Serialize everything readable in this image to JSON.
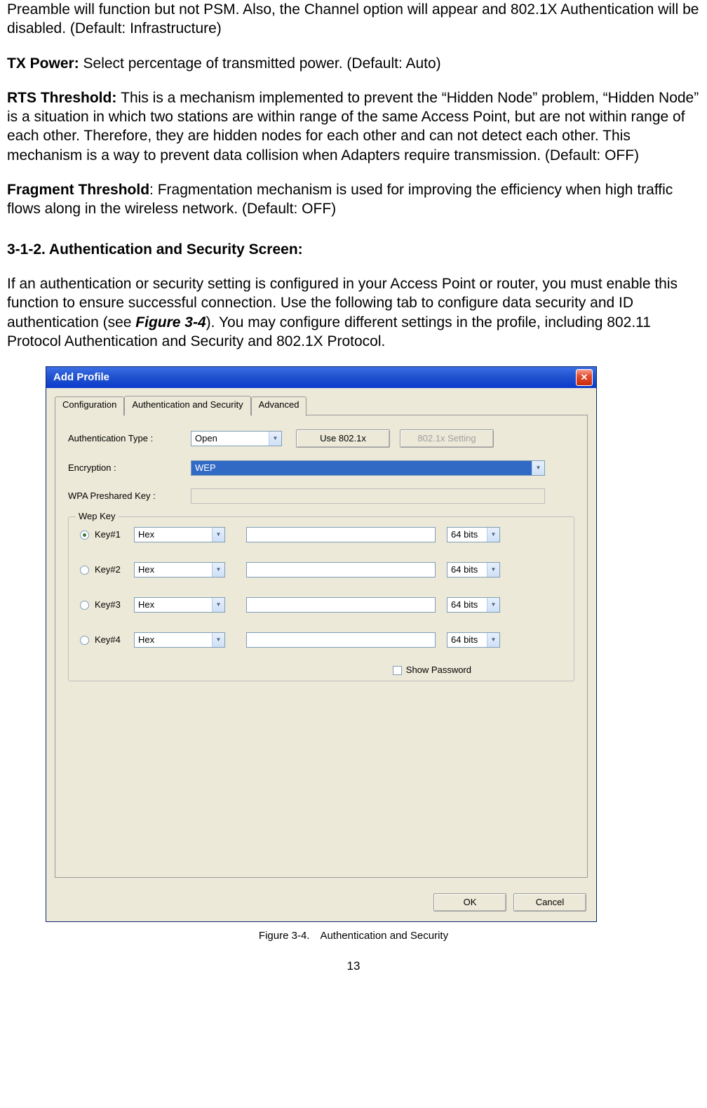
{
  "doc": {
    "para1": "Preamble will function but not PSM. Also, the Channel option will appear and 802.1X Authentication will be disabled. (Default: Infrastructure)",
    "tx_label": "TX Power: ",
    "tx_text": "Select percentage of transmitted power. (Default: Auto)",
    "rts_label": "RTS Threshold: ",
    "rts_text": "This is a mechanism implemented to prevent the “Hidden Node” problem, “Hidden Node” is a situation in which two stations are within range of the same Access Point, but are not within range of each other. Therefore, they are hidden nodes for each other and can not detect each other. This mechanism is a way to prevent data collision when Adapters require transmission. (Default: OFF)",
    "frag_label": "Fragment Threshold",
    "frag_text": ": Fragmentation mechanism is used for improving the efficiency when high traffic flows along in the wireless network. (Default: OFF)",
    "section_heading": "3-1-2. Authentication and Security Screen:",
    "para_intro_a": "If an authentication or security setting is configured in your Access Point or router, you must enable this function to ensure successful connection. Use the following tab to configure data security and ID authentication (see ",
    "para_intro_figref": "Figure 3-4",
    "para_intro_b": "). You may configure different settings in the profile, including 802.11 Protocol Authentication and Security and 802.1X Protocol.",
    "figure_caption": "Figure 3-4. Authentication and Security",
    "page_number": "13"
  },
  "dialog": {
    "title": "Add Profile",
    "tabs": [
      "Configuration",
      "Authentication and Security",
      "Advanced"
    ],
    "auth_type_label": "Authentication Type :",
    "auth_type_value": "Open",
    "use8021x_label": "Use 802.1x",
    "setting8021x_label": "802.1x Setting",
    "encryption_label": "Encryption :",
    "encryption_value": "WEP",
    "wpa_label": "WPA Preshared Key :",
    "wepkey_legend": "Wep Key",
    "keys": [
      {
        "label": "Key#1",
        "format": "Hex",
        "bits": "64 bits",
        "selected": true
      },
      {
        "label": "Key#2",
        "format": "Hex",
        "bits": "64 bits",
        "selected": false
      },
      {
        "label": "Key#3",
        "format": "Hex",
        "bits": "64 bits",
        "selected": false
      },
      {
        "label": "Key#4",
        "format": "Hex",
        "bits": "64 bits",
        "selected": false
      }
    ],
    "show_password_label": "Show Password",
    "ok_label": "OK",
    "cancel_label": "Cancel"
  }
}
